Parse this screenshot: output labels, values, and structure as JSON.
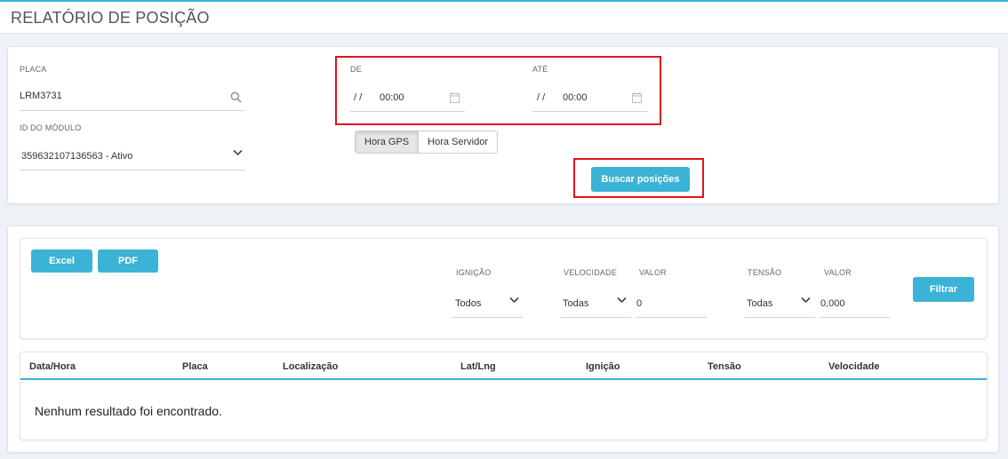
{
  "header": {
    "title": "RELATÓRIO DE POSIÇÃO"
  },
  "filters": {
    "placa": {
      "label": "PLACA",
      "value": "LRM3731"
    },
    "modulo": {
      "label": "ID DO MÓDULO",
      "value": "359632107136563 - Ativo"
    },
    "de": {
      "label": "DE",
      "date": "/ /",
      "time": "00:00"
    },
    "ate": {
      "label": "ATÉ",
      "date": "/ /",
      "time": "00:00"
    },
    "time_mode": {
      "options": [
        "Hora GPS",
        "Hora Servidor"
      ],
      "selected": "Hora GPS"
    },
    "search_button": "Buscar posições"
  },
  "toolbar": {
    "excel": "Excel",
    "pdf": "PDF",
    "ignicao": {
      "label": "IGNIÇÃO",
      "value": "Todos"
    },
    "velocidade": {
      "label": "VELOCIDADE",
      "value": "Todas"
    },
    "velocidade_valor": {
      "label": "VALOR",
      "value": "0"
    },
    "tensao": {
      "label": "TENSÃO",
      "value": "Todas"
    },
    "tensao_valor": {
      "label": "VALOR",
      "value": "0,000"
    },
    "filter_button": "Filtrar"
  },
  "table": {
    "columns": [
      "Data/Hora",
      "Placa",
      "Localização",
      "Lat/Lng",
      "Ignição",
      "Tensão",
      "Velocidade"
    ],
    "empty_message": "Nenhum resultado foi encontrado."
  },
  "colors": {
    "accent": "#3bb3d6",
    "highlight": "#e3141b"
  },
  "icons": [
    "search-icon",
    "chevron-down-icon",
    "calendar-icon"
  ]
}
